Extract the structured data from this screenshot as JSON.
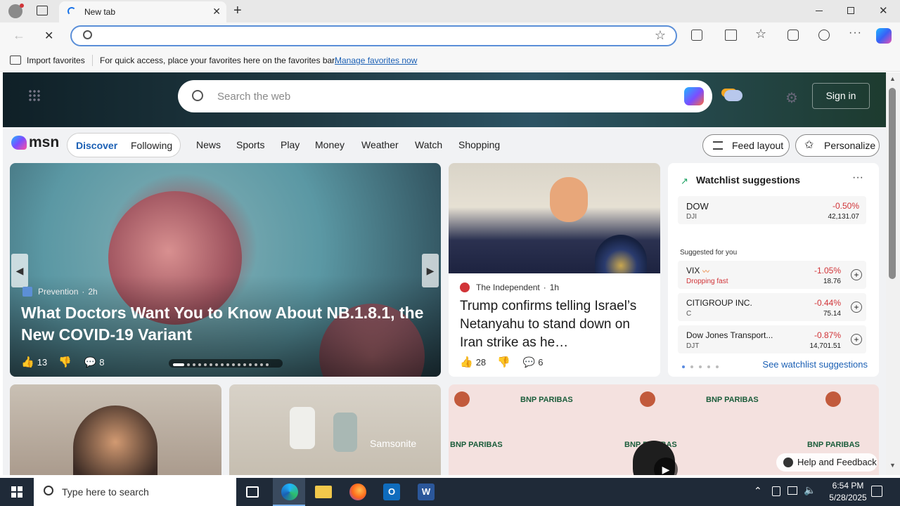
{
  "browser": {
    "tab_title": "New tab",
    "address_placeholder": "",
    "fav_import": "Import favorites",
    "fav_hint": "For quick access, place your favorites here on the favorites bar.",
    "fav_manage": "Manage favorites now"
  },
  "msn": {
    "search_placeholder": "Search the web",
    "sign_in": "Sign in",
    "logo": "msn",
    "tabs": [
      "Discover",
      "Following"
    ],
    "nav": [
      "News",
      "Sports",
      "Play",
      "Money",
      "Weather",
      "Watch",
      "Shopping"
    ],
    "feed_layout": "Feed layout",
    "personalize": "Personalize"
  },
  "hero_story": {
    "source": "Prevention",
    "age": "2h",
    "title": "What Doctors Want You to Know About NB.1.8.1, the New COVID-19 Variant",
    "likes": "13",
    "comments": "8"
  },
  "story2": {
    "source": "The Independent",
    "age": "1h",
    "title": "Trump confirms telling Israel’s Netanyahu to stand down on Iran strike as he…",
    "likes": "28",
    "comments": "6"
  },
  "watchlist": {
    "title": "Watchlist suggestions",
    "dow": {
      "name": "DOW",
      "sub": "DJI",
      "change": "-0.50%",
      "value": "42,131.07"
    },
    "suggested_label": "Suggested for you",
    "items": [
      {
        "name": "VIX",
        "sub": "Dropping fast",
        "change": "-1.05%",
        "value": "18.76"
      },
      {
        "name": "CITIGROUP INC.",
        "sub": "C",
        "change": "-0.44%",
        "value": "75.14"
      },
      {
        "name": "Dow Jones Transport...",
        "sub": "DJT",
        "change": "-0.87%",
        "value": "14,701.51"
      }
    ],
    "see_more": "See watchlist suggestions",
    "negative_color": "#d13438"
  },
  "bottom": {
    "samsonite": "Samsonite",
    "bnp": "BNP PARIBAS",
    "help": "Help and Feedback"
  },
  "taskbar": {
    "search_placeholder": "Type here to search",
    "time": "6:54 PM",
    "date": "5/28/2025"
  }
}
